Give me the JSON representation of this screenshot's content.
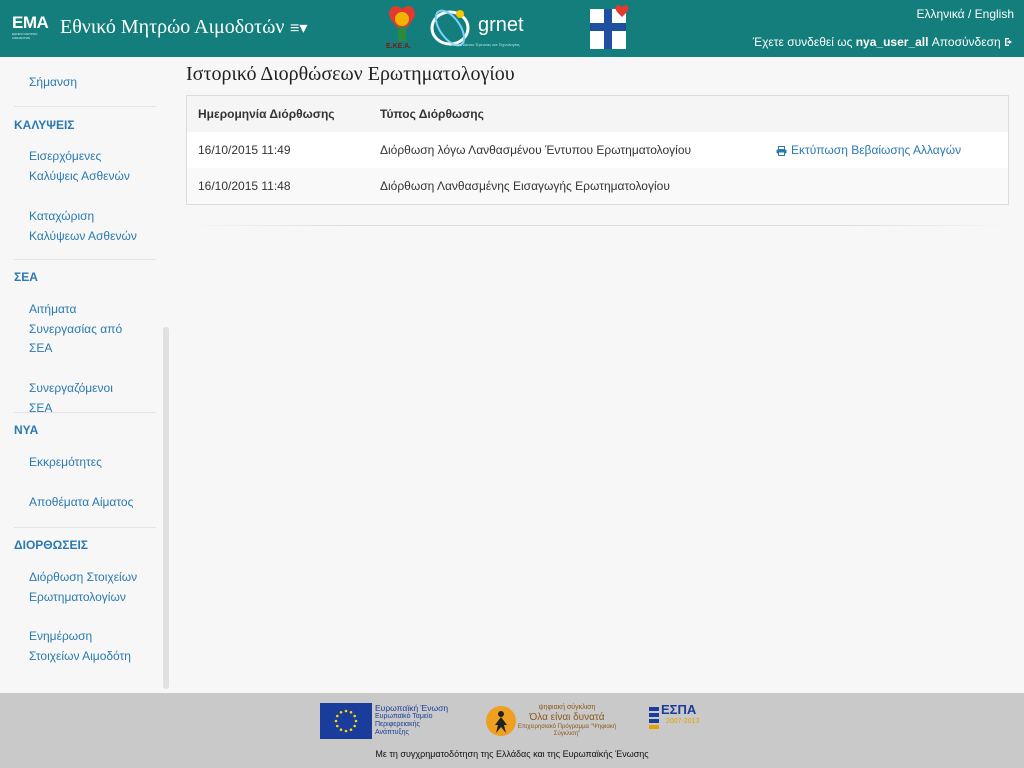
{
  "header": {
    "logo_text": "EMA",
    "logo_subtext": "ΕΘΝΙΚΟ ΜΗΤΡΩΟ ΑΙΜΟΔΟΤΩΝ",
    "title": "Εθνικό Μητρώο Αιμοδοτών",
    "menu_toggle": "≡▾",
    "partner_logos": {
      "ekea_text": "Ε.ΚΕ.Α.",
      "grnet_text": "grnet",
      "grnet_sub": "Εθνικό Δίκτυο Έρευνας και Τεχνολογίας"
    },
    "lang_greek": "Ελληνικά",
    "lang_sep": "/",
    "lang_english": "English",
    "user_prefix": "Έχετε συνδεθεί ως",
    "username": "nya_user_all",
    "logout_label": "Αποσύνδεση",
    "logout_icon": "sign-out-icon"
  },
  "sidebar": {
    "item_top": "Σήμανση",
    "sections": [
      {
        "header": "ΚΑΛΥΨΕΙΣ",
        "items": [
          "Εισερχόμενες Καλύψεις Ασθενών",
          "Καταχώριση Καλύψεων Ασθενών"
        ]
      },
      {
        "header": "ΣΕΑ",
        "items": [
          "Αιτήματα Συνεργασίας από ΣΕΑ",
          "Συνεργαζόμενοι ΣΕΑ"
        ]
      },
      {
        "header": "ΝΥΑ",
        "items": [
          "Εκκρεμότητες",
          "Αποθέματα Αίματος"
        ]
      },
      {
        "header": "ΔΙΟΡΘΩΣΕΙΣ",
        "items": [
          "Διόρθωση Στοιχείων Ερωτηματολογίων",
          "Ενημέρωση Στοιχείων Αιμοδότη"
        ]
      }
    ]
  },
  "main": {
    "title": "Ιστορικό Διορθώσεων Ερωτηματολογίου",
    "table": {
      "columns": [
        "Ημερομηνία Διόρθωσης",
        "Τύπος Διόρθωσης"
      ],
      "rows": [
        {
          "date": "16/10/2015 11:49",
          "type": "Διόρθωση λόγω Λανθασμένου Έντυπου Ερωτηματολογίου",
          "action": "Εκτύπωση Βεβαίωσης Αλλαγών",
          "action_icon": "print-icon"
        },
        {
          "date": "16/10/2015 11:48",
          "type": "Διόρθωση Λανθασμένης Εισαγωγής Ερωτηματολογίου",
          "action": ""
        }
      ]
    }
  },
  "footer": {
    "eu_title": "Ευρωπαϊκή Ένωση",
    "eu_fund": "Ευρωπαϊκό Ταμείο Περιφερειακής Ανάπτυξης",
    "digital_title": "ψηφιακή σύγκλιση",
    "digital_slogan": "Όλα είναι δυνατά",
    "digital_sub": "Επιχειρησιακό Πρόγραμμα \"Ψηφιακή Σύγκλιση\"",
    "espa_title": "ΕΣΠΑ",
    "espa_years": "2007-2013",
    "cofund_text": "Με τη συγχρηματοδότηση της Ελλάδας και της Ευρωπαϊκής Ένωσης"
  },
  "colors": {
    "header_bg": "#137e7c",
    "link": "#2a7ab0",
    "footer_bg": "#c9c9c9"
  }
}
